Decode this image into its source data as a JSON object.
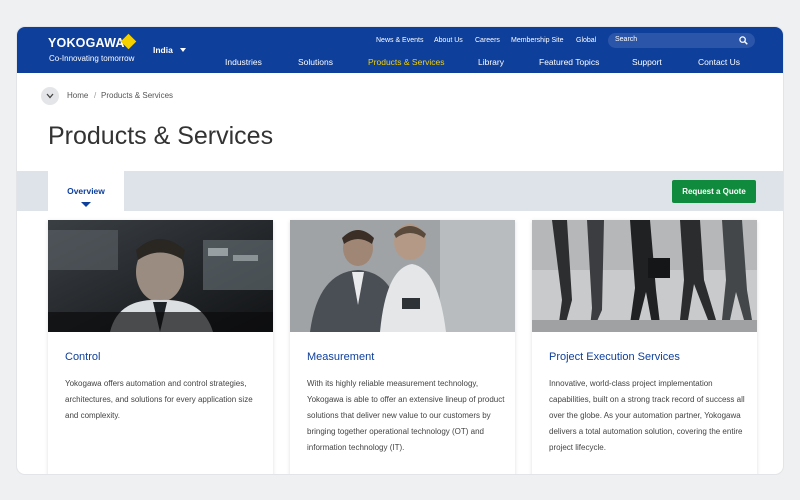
{
  "brand": {
    "logo": "YOKOGAWA",
    "tagline": "Co-Innovating tomorrow",
    "logo_color": "#f5d000"
  },
  "region": {
    "label": "India"
  },
  "utility_nav": [
    "News & Events",
    "About Us",
    "Careers",
    "Membership Site",
    "Global"
  ],
  "search": {
    "placeholder": "Search",
    "icon": "search-icon"
  },
  "main_nav": {
    "items": [
      "Industries",
      "Solutions",
      "Products & Services",
      "Library",
      "Featured Topics",
      "Support",
      "Contact Us"
    ],
    "active": "Products & Services"
  },
  "breadcrumb": {
    "home": "Home",
    "separator": "/",
    "current": "Products & Services"
  },
  "page": {
    "title": "Products & Services"
  },
  "tabs": {
    "overview": "Overview"
  },
  "actions": {
    "request_quote": "Request a Quote"
  },
  "cards": [
    {
      "title": "Control",
      "text": "Yokogawa offers automation and control strategies, architectures, and solutions for every application size and complexity."
    },
    {
      "title": "Measurement",
      "text": "With its highly reliable measurement technology, Yokogawa is able to offer an extensive lineup of product solutions that deliver new value to our customers by bringing together operational technology (OT) and information technology (IT)."
    },
    {
      "title": "Project Execution Services",
      "text": "Innovative, world-class project implementation capabilities, built on a strong track record of success all over the globe. As your automation partner, Yokogawa delivers a total automation solution, covering the entire project lifecycle."
    }
  ],
  "colors": {
    "header": "#0e3f9b",
    "active_nav": "#f5d000",
    "cta": "#108a3c",
    "tabs_bar": "#dde3e8"
  }
}
